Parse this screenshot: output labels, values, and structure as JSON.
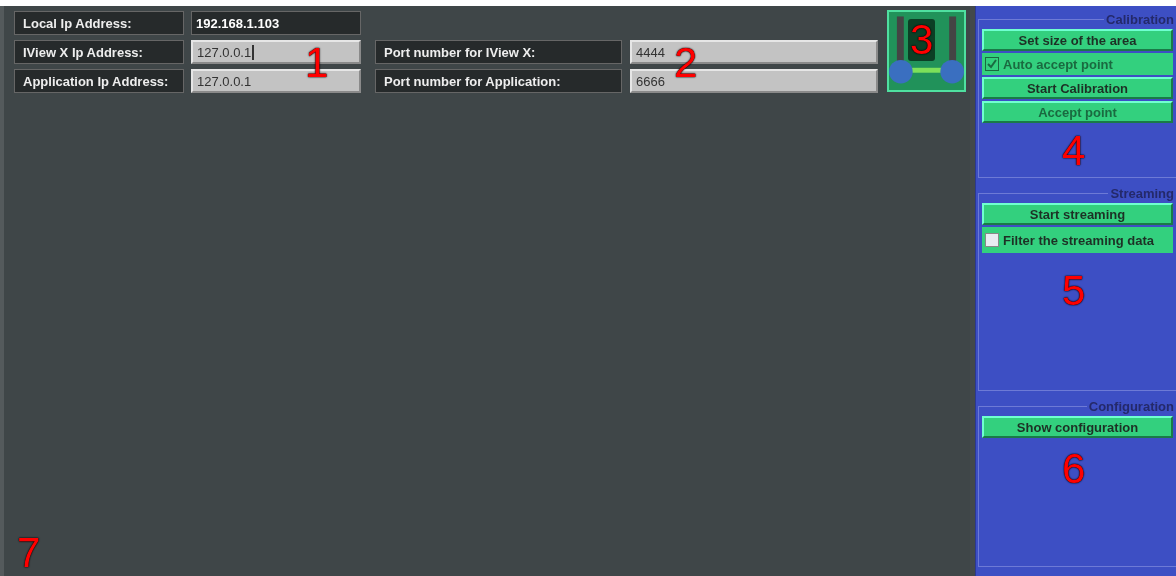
{
  "address_rows": [
    {
      "label": "Local Ip Address:",
      "value": "192.168.1.103",
      "kind": "readonly",
      "focused": false
    },
    {
      "label": "IView X Ip Address:",
      "value": "127.0.0.1",
      "kind": "editable",
      "focused": true
    },
    {
      "label": "Application Ip Address:",
      "value": "127.0.0.1",
      "kind": "editable",
      "focused": false
    }
  ],
  "port_rows": [
    {
      "label": "Port number for IView X:",
      "value": "4444",
      "kind": "editable",
      "focused": false
    },
    {
      "label": "Port number for Application:",
      "value": "6666",
      "kind": "editable",
      "focused": false
    }
  ],
  "groups": [
    {
      "title": "Calibration",
      "items": [
        {
          "kind": "button",
          "label": "Set size of the area",
          "disabled": false
        },
        {
          "kind": "checkbox",
          "label": "Auto accept point",
          "checked": true,
          "disabled": true
        },
        {
          "kind": "button",
          "label": "Start Calibration",
          "disabled": false
        },
        {
          "kind": "button",
          "label": "Accept point",
          "disabled": true
        }
      ]
    },
    {
      "title": "Streaming",
      "items": [
        {
          "kind": "button",
          "label": "Start streaming",
          "disabled": false
        },
        {
          "kind": "checkbox",
          "label": "Filter the streaming data",
          "checked": false,
          "disabled": false
        }
      ]
    },
    {
      "title": "Configuration",
      "items": [
        {
          "kind": "button",
          "label": "Show configuration",
          "disabled": false
        }
      ]
    }
  ],
  "callouts": [
    "1",
    "2",
    "3",
    "4",
    "5",
    "6",
    "7"
  ]
}
